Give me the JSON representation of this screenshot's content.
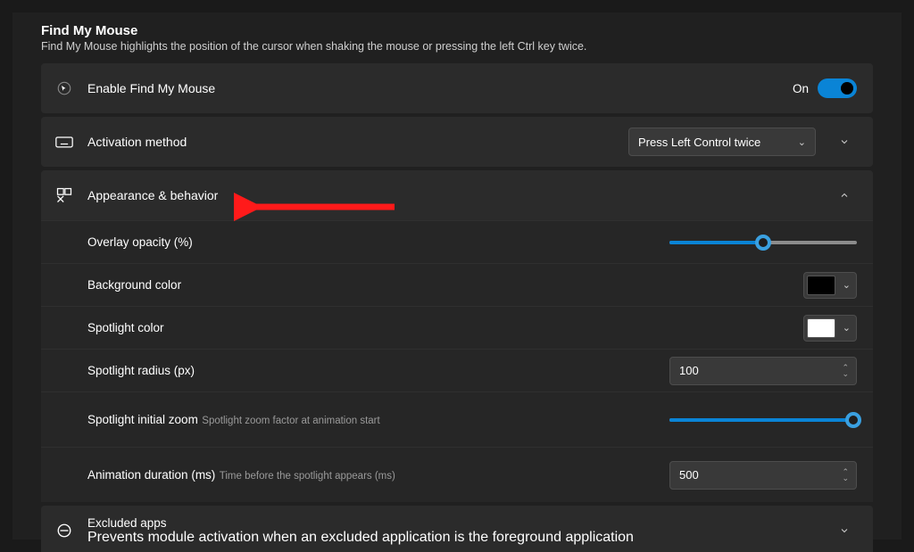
{
  "header": {
    "title": "Find My Mouse",
    "description": "Find My Mouse highlights the position of the cursor when shaking the mouse or pressing the left Ctrl key twice."
  },
  "enable": {
    "label": "Enable Find My Mouse",
    "state": "On",
    "value": true
  },
  "activation": {
    "label": "Activation method",
    "value": "Press Left Control twice"
  },
  "appearance": {
    "label": "Appearance & behavior",
    "opacity": {
      "label": "Overlay opacity (%)",
      "value": 50
    },
    "background_color": {
      "label": "Background color",
      "value": "#000000"
    },
    "spotlight_color": {
      "label": "Spotlight color",
      "value": "#FFFFFF"
    },
    "spotlight_radius": {
      "label": "Spotlight radius (px)",
      "value": "100"
    },
    "spotlight_zoom": {
      "label": "Spotlight initial zoom",
      "sub": "Spotlight zoom factor at animation start",
      "value": 100
    },
    "animation_duration": {
      "label": "Animation duration (ms)",
      "sub": "Time before the spotlight appears (ms)",
      "value": "500"
    }
  },
  "excluded": {
    "label": "Excluded apps",
    "sub": "Prevents module activation when an excluded application is the foreground application"
  }
}
